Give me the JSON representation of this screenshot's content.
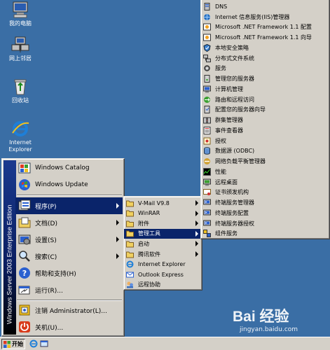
{
  "desktop": {
    "icons": [
      {
        "label": "我的电脑",
        "icon": "my-computer-icon"
      },
      {
        "label": "网上邻居",
        "icon": "network-places-icon"
      },
      {
        "label": "回收站",
        "icon": "recycle-bin-icon"
      },
      {
        "label": "Internet Explorer",
        "icon": "internet-explorer-icon"
      }
    ]
  },
  "start_menu": {
    "banner": "Windows Server 2003 Enterprise Edition",
    "items": [
      {
        "label": "Windows Catalog",
        "icon": "windows-catalog-icon"
      },
      {
        "label": "Windows Update",
        "icon": "windows-update-icon"
      },
      {
        "label": "程序(P)",
        "icon": "programs-icon",
        "submenu": true,
        "selected": true
      },
      {
        "label": "文档(D)",
        "icon": "documents-icon",
        "submenu": true
      },
      {
        "label": "设置(S)",
        "icon": "settings-icon",
        "submenu": true
      },
      {
        "label": "搜索(C)",
        "icon": "search-icon",
        "submenu": true
      },
      {
        "label": "帮助和支持(H)",
        "icon": "help-icon"
      },
      {
        "label": "运行(R)...",
        "icon": "run-icon"
      },
      {
        "label": "注销 Administrator(L)...",
        "icon": "logoff-icon"
      },
      {
        "label": "关机(U)...",
        "icon": "shutdown-icon"
      }
    ]
  },
  "programs_menu": {
    "items": [
      {
        "label": "V-Mail V9.8",
        "icon": "folder-icon",
        "submenu": true
      },
      {
        "label": "WinRAR",
        "icon": "folder-icon",
        "submenu": true
      },
      {
        "label": "附件",
        "icon": "folder-icon",
        "submenu": true
      },
      {
        "label": "管理工具",
        "icon": "folder-icon",
        "submenu": true,
        "selected": true
      },
      {
        "label": "启动",
        "icon": "folder-icon",
        "submenu": true
      },
      {
        "label": "腾讯软件",
        "icon": "folder-icon",
        "submenu": true
      },
      {
        "label": "Internet Explorer",
        "icon": "internet-explorer-icon"
      },
      {
        "label": "Outlook Express",
        "icon": "outlook-express-icon"
      },
      {
        "label": "远程协助",
        "icon": "remote-assistance-icon"
      }
    ]
  },
  "admin_tools_menu": {
    "items": [
      {
        "label": "DNS",
        "icon": "dns-icon"
      },
      {
        "label": "Internet 信息服务(IIS)管理器",
        "icon": "iis-icon"
      },
      {
        "label": "Microsoft .NET Framework 1.1 配置",
        "icon": "dotnet-icon"
      },
      {
        "label": "Microsoft .NET Framework 1.1 向导",
        "icon": "dotnet-icon"
      },
      {
        "label": "本地安全策略",
        "icon": "security-policy-icon"
      },
      {
        "label": "分布式文件系统",
        "icon": "dfs-icon"
      },
      {
        "label": "服务",
        "icon": "services-icon"
      },
      {
        "label": "管理您的服务器",
        "icon": "manage-server-icon"
      },
      {
        "label": "计算机管理",
        "icon": "computer-management-icon"
      },
      {
        "label": "路由和远程访问",
        "icon": "routing-icon"
      },
      {
        "label": "配置您的服务器向导",
        "icon": "configure-server-icon"
      },
      {
        "label": "群集管理器",
        "icon": "cluster-icon"
      },
      {
        "label": "事件查看器",
        "icon": "event-viewer-icon"
      },
      {
        "label": "授权",
        "icon": "licensing-icon"
      },
      {
        "label": "数据源 (ODBC)",
        "icon": "odbc-icon"
      },
      {
        "label": "网络负载平衡管理器",
        "icon": "nlb-icon"
      },
      {
        "label": "性能",
        "icon": "performance-icon"
      },
      {
        "label": "远程桌面",
        "icon": "remote-desktop-icon"
      },
      {
        "label": "证书颁发机构",
        "icon": "certificate-icon"
      },
      {
        "label": "终端服务管理器",
        "icon": "terminal-services-icon"
      },
      {
        "label": "终端服务配置",
        "icon": "terminal-services-icon"
      },
      {
        "label": "终端服务器授权",
        "icon": "terminal-services-icon"
      },
      {
        "label": "组件服务",
        "icon": "component-services-icon"
      }
    ]
  },
  "taskbar": {
    "start_label": "开始",
    "quick_launch": [
      "ie-quicklaunch-icon",
      "desktop-quicklaunch-icon"
    ]
  },
  "watermark": {
    "main": "Bai 经验",
    "sub": "jingyan.baidu.com"
  },
  "colors": {
    "desktop": "#3a6ea5",
    "menu": "#d4d0c8",
    "highlight": "#0a246a"
  }
}
